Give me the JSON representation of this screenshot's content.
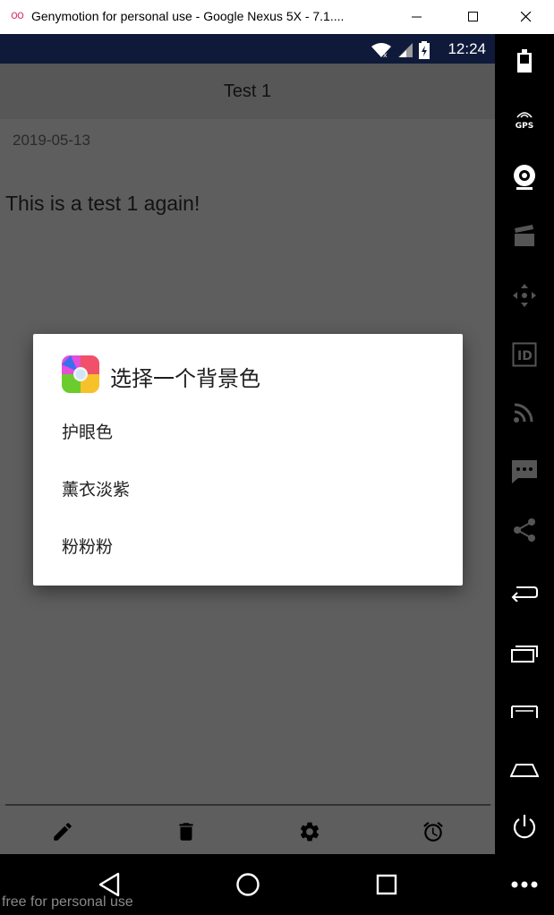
{
  "window": {
    "logo": "oo",
    "title": "Genymotion for personal use - Google Nexus 5X - 7.1...."
  },
  "statusbar": {
    "time": "12:24"
  },
  "appbar": {
    "title": "Test 1"
  },
  "note": {
    "date": "2019-05-13",
    "body": "This is a test 1 again!"
  },
  "dialog": {
    "title": "选择一个背景色",
    "items": [
      {
        "label": "护眼色"
      },
      {
        "label": "薰衣淡紫"
      },
      {
        "label": "粉粉粉"
      }
    ]
  },
  "toolbar": {
    "icons": [
      "edit-icon",
      "delete-icon",
      "settings-icon",
      "alarm-icon"
    ]
  },
  "navbar": {
    "icons": [
      "back-icon",
      "home-icon",
      "recents-icon"
    ]
  },
  "sidepanel": {
    "gps_label": "GPS",
    "id_label": "ID",
    "icons": [
      "battery-icon",
      "gps-icon",
      "camera-icon",
      "capture-icon",
      "dpad-icon",
      "id-icon",
      "cast-icon",
      "sms-icon",
      "share-icon",
      "back-icon",
      "recents-icon",
      "menu-icon",
      "home-icon",
      "power-icon",
      "more-icon"
    ]
  },
  "watermark": "free for personal use",
  "colors": {
    "statusbar": "#0f1a3a",
    "screen": "#5e5e5e",
    "dialog": "#ffffff"
  }
}
